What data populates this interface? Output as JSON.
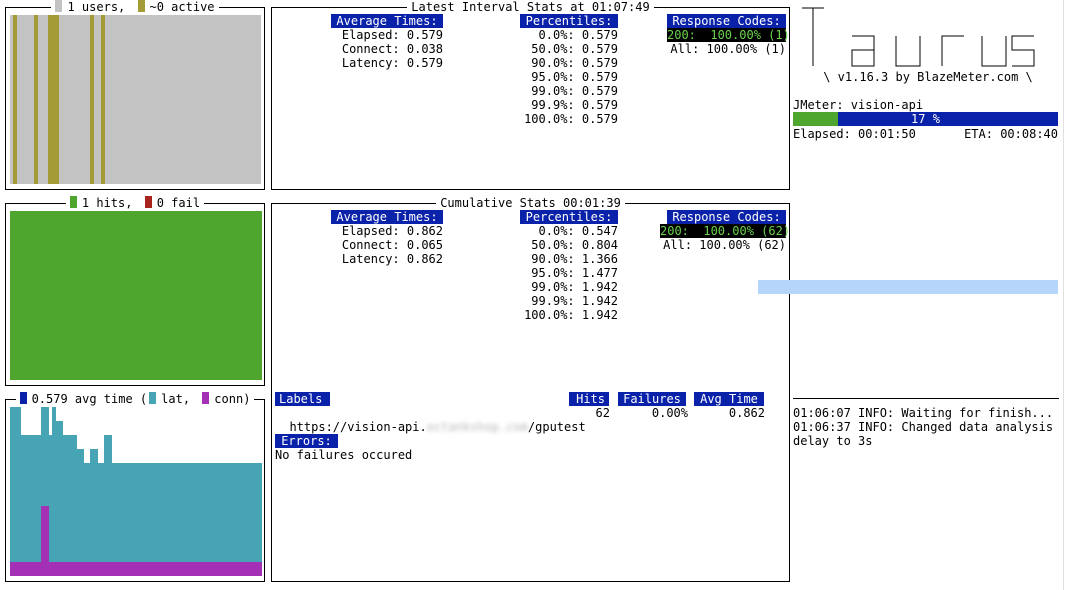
{
  "users_panel": {
    "title_users": "1 users,",
    "title_active": "~0 active"
  },
  "hits_panel": {
    "title_hits": "1 hits,",
    "title_fail": "0 fail"
  },
  "time_panel": {
    "title_avg": "0.579 avg time (",
    "title_lat": "lat,",
    "title_conn": "conn)"
  },
  "latest": {
    "title": "Latest Interval Stats at 01:07:49",
    "avg_header": "Average Times:",
    "avg_rows": [
      "Elapsed: 0.579",
      "Connect: 0.038",
      "Latency: 0.579"
    ],
    "pct_header": "Percentiles:",
    "pct_rows": [
      "0.0%: 0.579",
      "50.0%: 0.579",
      "90.0%: 0.579",
      "95.0%: 0.579",
      "99.0%: 0.579",
      "99.9%: 0.579",
      "100.0%: 0.579"
    ],
    "rc_header": "Response Codes:",
    "rc_selected": "200:  100.00% (1)",
    "rc_all": "All: 100.00% (1)"
  },
  "cumulative": {
    "title": "Cumulative Stats 00:01:39",
    "avg_header": "Average Times:",
    "avg_rows": [
      "Elapsed: 0.862",
      "Connect: 0.065",
      "Latency: 0.862"
    ],
    "pct_header": "Percentiles:",
    "pct_rows": [
      "0.0%: 0.547",
      "50.0%: 0.804",
      "90.0%: 1.366",
      "95.0%: 1.477",
      "99.0%: 1.942",
      "99.9%: 1.942",
      "100.0%: 1.942"
    ],
    "rc_header": "Response Codes:",
    "rc_selected": "200:  100.00% (62)",
    "rc_all": "All: 100.00% (62)"
  },
  "labels_table": {
    "headers": {
      "labels": "Labels",
      "hits": "Hits",
      "failures": "Failures",
      "avg_time": "Avg Time"
    },
    "rows": [
      {
        "label_prefix": "https://vision-api.",
        "label_blurred": "octankshop.com",
        "label_suffix": "/gputest",
        "hits": "62",
        "failures": "0.00%",
        "avg_time": "0.862"
      }
    ],
    "errors_header": "Errors:",
    "errors_text": "No failures occured"
  },
  "taurus": {
    "logo": "Taurus",
    "version": "\\ v1.16.3 by BlazeMeter.com \\",
    "executor": "JMeter: vision-api",
    "progress_label": "17 %",
    "progress_fraction": 0.17,
    "elapsed": "Elapsed: 00:01:50",
    "eta": "ETA: 00:08:40"
  },
  "log": {
    "lines": [
      "01:06:07 INFO: Waiting for finish...",
      "01:06:37 INFO: Changed data analysis",
      "delay to 3s"
    ]
  },
  "colors": {
    "header_bg": "#0a22aa",
    "users": "#a39c36",
    "users_bg": "#c3c3c3",
    "hits": "#4ea62f",
    "fail": "#a7231c",
    "lat": "#46a4b5",
    "conn": "#a430b5",
    "avg": "#0a22aa",
    "progress_done": "#4ea62f",
    "progress_todo": "#0a22aa",
    "highlight": "#b5d5fb"
  },
  "chart_data": [
    {
      "type": "bar",
      "title": "1 users, ~0 active",
      "series": [
        {
          "name": "users",
          "values": [
            0,
            1,
            0,
            0,
            0,
            0,
            0,
            1,
            0,
            0,
            0,
            1,
            1,
            1,
            0,
            0,
            0,
            0,
            0,
            0,
            0,
            0,
            0,
            1,
            0,
            0,
            1,
            0,
            0,
            0,
            0,
            0,
            0,
            0,
            0,
            0,
            0,
            0,
            0,
            0,
            0,
            0,
            0,
            0,
            0,
            0,
            0,
            0,
            0,
            0,
            0,
            0,
            0,
            0,
            0,
            0,
            0,
            0,
            0,
            0,
            0,
            0,
            0,
            0,
            0,
            0,
            0,
            0,
            0,
            0,
            0,
            0
          ]
        }
      ]
    },
    {
      "type": "bar",
      "title": "1 hits, 0 fail",
      "series": [
        {
          "name": "hits",
          "values": [
            1,
            1,
            1,
            1,
            1,
            1,
            1,
            1,
            1,
            1,
            1,
            1,
            1,
            1,
            1,
            1,
            1,
            1,
            1,
            1,
            1,
            1,
            1,
            1,
            1,
            1,
            1,
            1,
            1,
            1,
            1,
            1,
            1,
            1,
            1,
            1,
            1,
            1,
            1,
            1,
            1,
            1,
            1,
            1,
            1,
            1,
            1,
            1,
            1,
            1,
            1,
            1,
            1,
            1,
            1,
            1,
            1,
            1,
            1,
            1,
            1,
            1,
            1,
            1,
            1,
            1,
            1,
            1,
            1,
            1,
            1,
            1
          ]
        },
        {
          "name": "fail",
          "values": [
            0
          ]
        }
      ]
    },
    {
      "type": "area",
      "title": "0.579 avg time ( lat, conn)",
      "series": [
        {
          "name": "lat",
          "values": [
            12,
            12,
            12,
            10,
            10,
            10,
            10,
            10,
            10,
            12,
            12,
            10,
            12,
            11,
            11,
            10,
            10,
            10,
            10,
            9,
            9,
            8,
            8,
            9,
            9,
            8,
            8,
            10,
            10,
            8,
            8,
            8,
            8,
            8,
            8,
            8,
            8,
            8,
            8,
            8,
            8,
            8,
            8,
            8,
            8,
            8,
            8,
            8,
            8,
            8,
            8,
            8,
            8,
            8,
            8,
            8,
            8,
            8,
            8,
            8,
            8,
            8,
            8,
            8,
            8,
            8,
            8,
            8,
            8,
            8,
            8,
            8
          ]
        },
        {
          "name": "conn",
          "values": [
            1,
            1,
            1,
            1,
            1,
            1,
            1,
            1,
            1,
            5,
            5,
            1,
            1,
            1,
            1,
            1,
            1,
            1,
            1,
            1,
            1,
            1,
            1,
            1,
            1,
            1,
            1,
            1,
            1,
            1,
            1,
            1,
            1,
            1,
            1,
            1,
            1,
            1,
            1,
            1,
            1,
            1,
            1,
            1,
            1,
            1,
            1,
            1,
            1,
            1,
            1,
            1,
            1,
            1,
            1,
            1,
            1,
            1,
            1,
            1,
            1,
            1,
            1,
            1,
            1,
            1,
            1,
            1,
            1,
            1,
            1,
            1
          ]
        }
      ]
    }
  ]
}
